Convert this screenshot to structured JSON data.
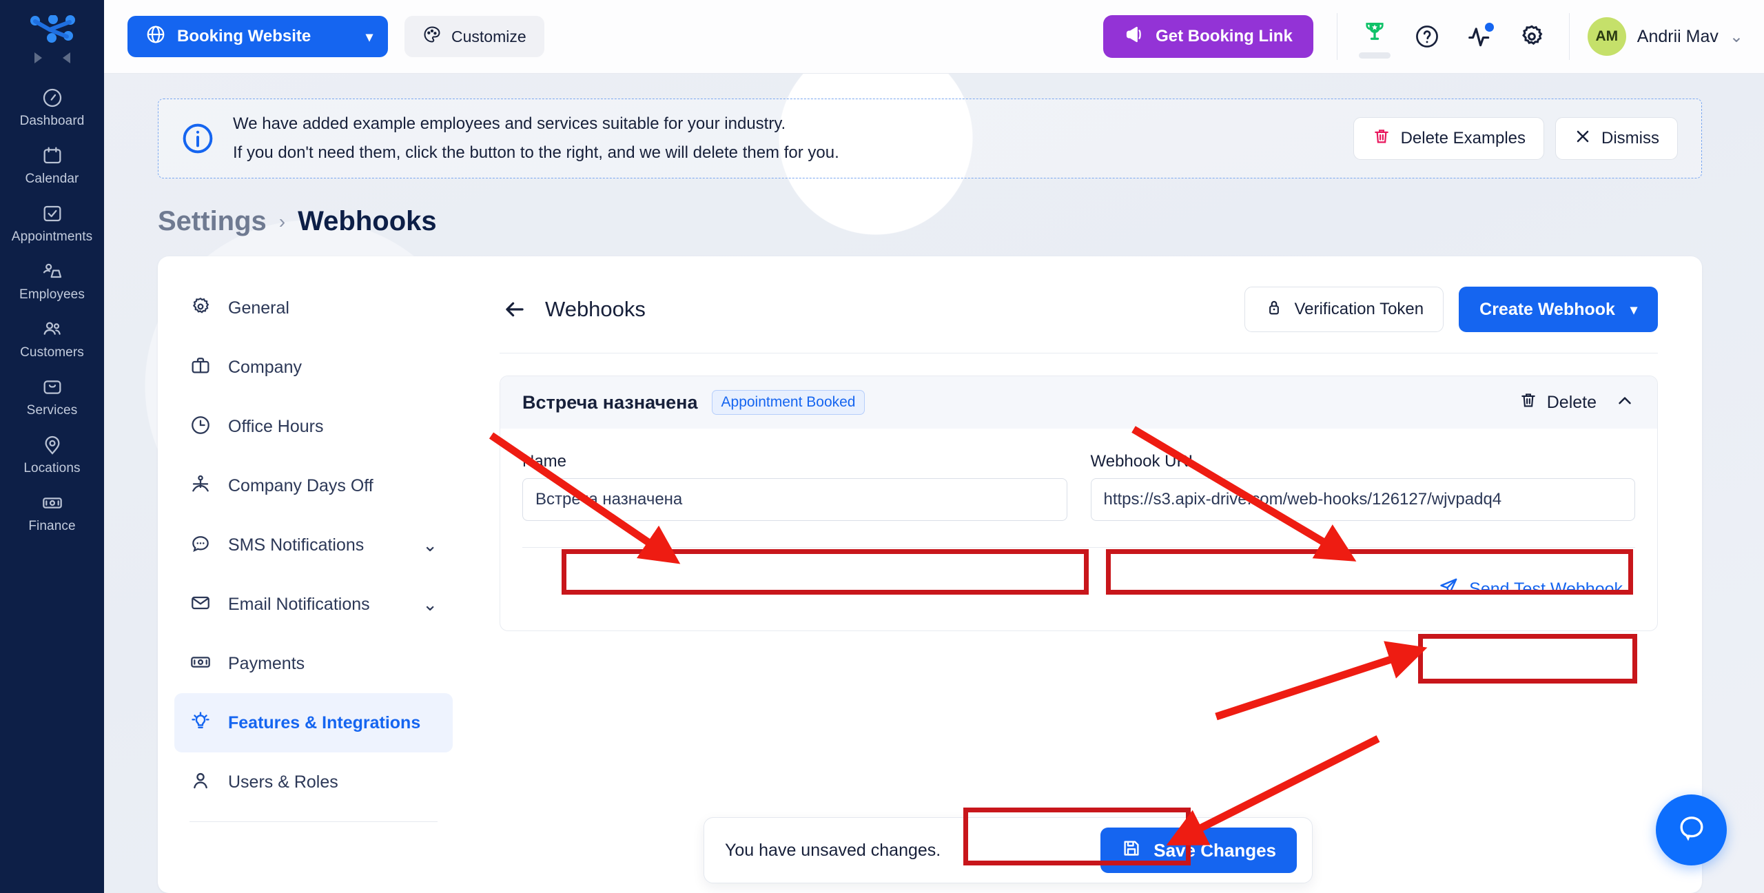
{
  "rail": {
    "logo_icon": "network-nodes-logo",
    "collapse_right_icon": "triangle-right-icon",
    "collapse_left_icon": "triangle-left-icon",
    "items": [
      {
        "label": "Dashboard",
        "icon": "gauge-icon"
      },
      {
        "label": "Calendar",
        "icon": "calendar-icon"
      },
      {
        "label": "Appointments",
        "icon": "checkbox-list-icon"
      },
      {
        "label": "Employees",
        "icon": "employee-icon"
      },
      {
        "label": "Customers",
        "icon": "customers-icon"
      },
      {
        "label": "Services",
        "icon": "services-box-icon"
      },
      {
        "label": "Locations",
        "icon": "map-pin-icon"
      },
      {
        "label": "Finance",
        "icon": "banknote-icon"
      }
    ]
  },
  "topbar": {
    "booking_website_label": "Booking Website",
    "booking_website_icon": "globe-icon",
    "booking_website_chevron": "▾",
    "customize_label": "Customize",
    "customize_icon": "palette-icon",
    "get_booking_link_label": "Get Booking Link",
    "get_booking_link_icon": "megaphone-icon",
    "trophy_icon": "trophy-icon",
    "help_icon": "question-circle-icon",
    "activity_icon": "activity-pulse-icon",
    "settings_icon": "gear-icon",
    "user_initials": "AM",
    "user_name": "Andrii Mav",
    "user_chevron": "⌄"
  },
  "banner": {
    "info_icon": "info-circle-icon",
    "line1": "We have added example employees and services suitable for your industry.",
    "line2": "If you don't need them, click the button to the right, and we will delete them for you.",
    "delete_examples_label": "Delete Examples",
    "delete_examples_icon": "trash-icon",
    "dismiss_label": "Dismiss",
    "dismiss_icon": "close-x-icon"
  },
  "breadcrumb": {
    "parent": "Settings",
    "separator": "›",
    "current": "Webhooks"
  },
  "settings_nav": {
    "items": [
      {
        "label": "General",
        "icon": "gear-icon",
        "active": false,
        "chevron": ""
      },
      {
        "label": "Company",
        "icon": "briefcase-icon",
        "active": false,
        "chevron": ""
      },
      {
        "label": "Office Hours",
        "icon": "clock-icon",
        "active": false,
        "chevron": ""
      },
      {
        "label": "Company Days Off",
        "icon": "beach-umbrella-icon",
        "active": false,
        "chevron": ""
      },
      {
        "label": "SMS Notifications",
        "icon": "chat-bubble-icon",
        "active": false,
        "chevron": "⌄"
      },
      {
        "label": "Email Notifications",
        "icon": "envelope-icon",
        "active": false,
        "chevron": "⌄"
      },
      {
        "label": "Payments",
        "icon": "banknote-icon",
        "active": false,
        "chevron": ""
      },
      {
        "label": "Features & Integrations",
        "icon": "lightbulb-icon",
        "active": true,
        "chevron": ""
      },
      {
        "label": "Users & Roles",
        "icon": "user-icon",
        "active": false,
        "chevron": ""
      }
    ]
  },
  "content": {
    "back_icon": "arrow-left-icon",
    "title": "Webhooks",
    "verification_token_label": "Verification Token",
    "verification_token_icon": "lock-icon",
    "create_webhook_label": "Create Webhook",
    "create_webhook_chevron": "▾"
  },
  "webhook_card": {
    "title": "Встреча назначена",
    "badge": "Appointment Booked",
    "delete_label": "Delete",
    "delete_icon": "trash-icon",
    "collapse_icon": "chevron-up-icon",
    "name_label": "Name",
    "name_value": "Встреча назначена",
    "url_label": "Webhook URL",
    "url_value": "https://s3.apix-drive.com/web-hooks/126127/wjvpadq4",
    "send_test_label": "Send Test Webhook",
    "send_test_icon": "send-paper-plane-icon"
  },
  "savebar": {
    "message": "You have unsaved changes.",
    "save_label": "Save Changes",
    "save_icon": "floppy-save-icon"
  },
  "help_widget": {
    "icon": "chat-bubble-icon"
  },
  "colors": {
    "rail_bg": "#0d1f47",
    "primary_blue": "#1565f0",
    "purple": "#9333d6",
    "pink_red": "#e8175d",
    "annotation_red": "#ee1c12",
    "highlight_red": "#c8161b",
    "avatar_green": "#c5e06a",
    "trophy_green": "#0ec268"
  },
  "annotations": {
    "highlight_boxes": 4,
    "arrows": 4
  }
}
